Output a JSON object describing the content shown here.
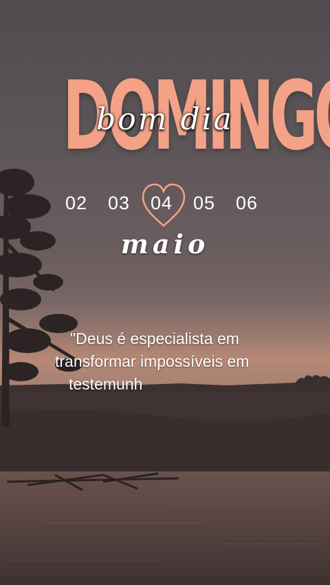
{
  "title": "DOMINGO",
  "greeting": "bom dia",
  "dates": [
    "02",
    "03",
    "04",
    "05",
    "06"
  ],
  "selected_date": "04",
  "month": "maio",
  "quote": {
    "line1": "\"Deus é especialista em",
    "line2": "transformar impossíveis em",
    "line3": "testemunh"
  },
  "colors": {
    "accent": "#f4a287",
    "text": "#ffffff"
  },
  "icons": [
    "heart-icon"
  ]
}
